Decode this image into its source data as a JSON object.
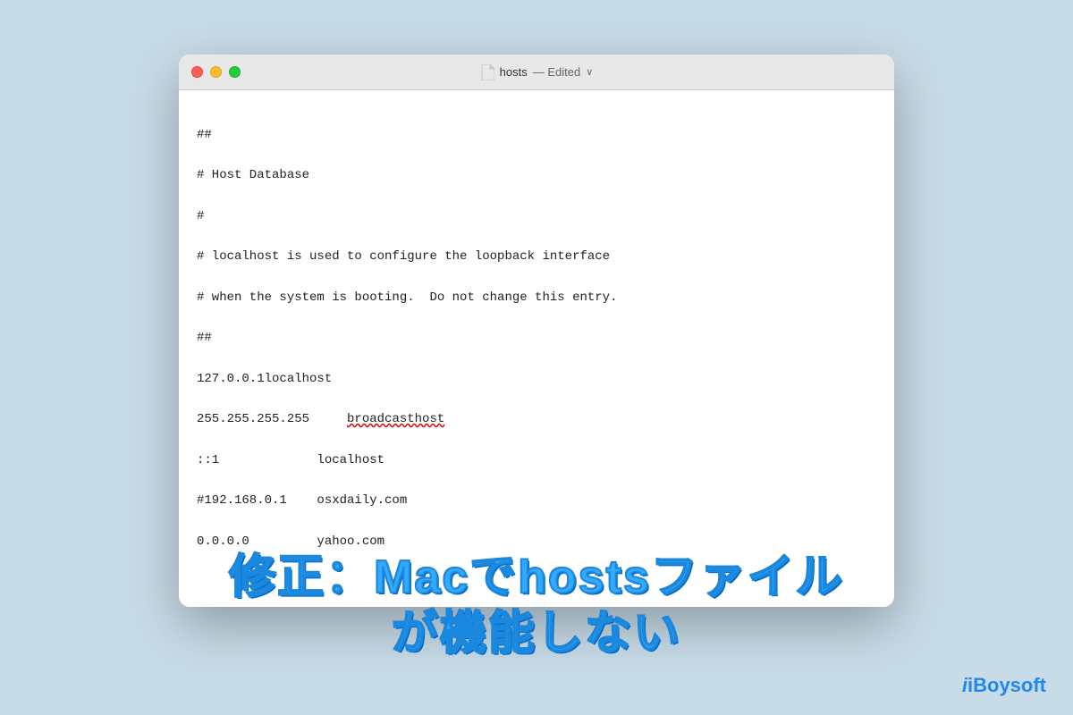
{
  "background_color": "#c8dce8",
  "window": {
    "title": "hosts",
    "edited_label": "Edited",
    "chevron": "∨"
  },
  "editor": {
    "lines": [
      "##",
      "# Host Database",
      "#",
      "# localhost is used to configure the loopback interface",
      "# when the system is booting.  Do not change this entry.",
      "##",
      "127.0.0.1localhost",
      "255.255.255.255\t    broadcasthost",
      "::1             localhost",
      "#192.168.0.1    osxdaily.com",
      "0.0.0.0         yahoo.com"
    ]
  },
  "overlay": {
    "line1": "修正：Macでhostsファイル",
    "line2": "が機能しない"
  },
  "branding": {
    "text": "iBoysoft"
  }
}
